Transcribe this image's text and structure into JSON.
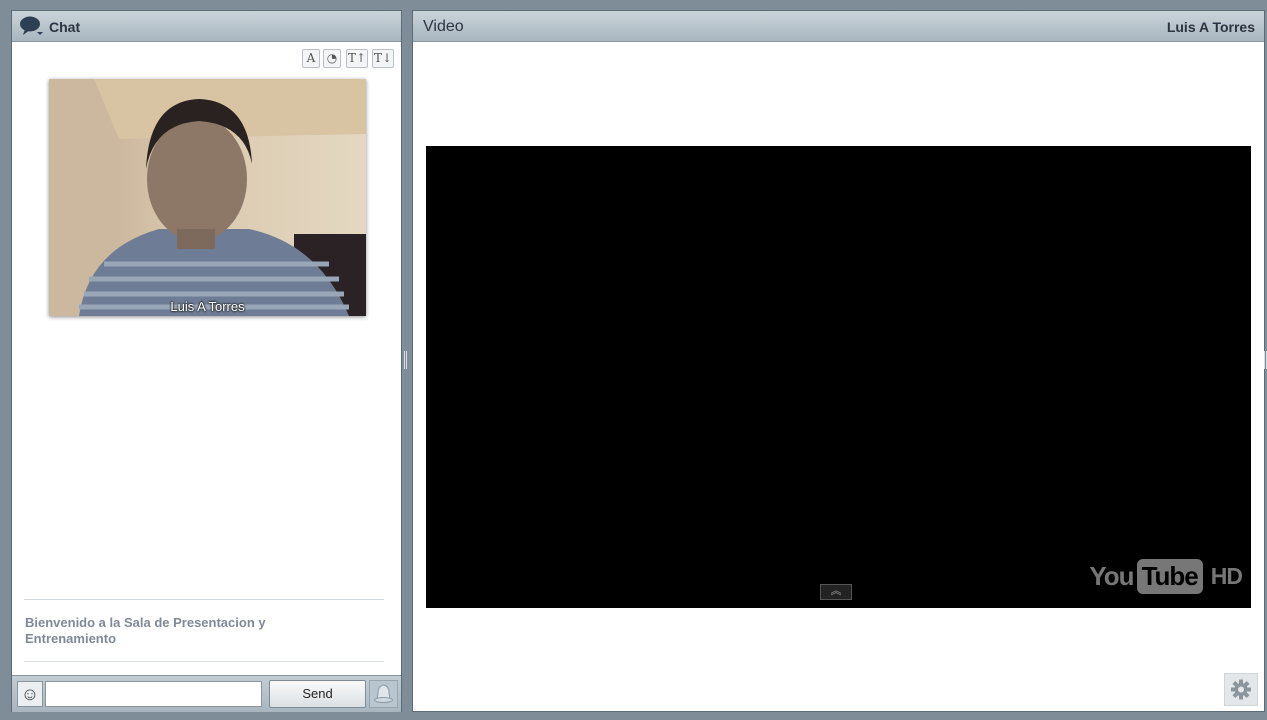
{
  "chat": {
    "title": "Chat",
    "toolbar": [
      {
        "name": "font-style-button",
        "glyph": "A"
      },
      {
        "name": "clock-button",
        "glyph": "◔"
      },
      {
        "name": "font-increase-button",
        "glyph": "T↑"
      },
      {
        "name": "font-decrease-button",
        "glyph": "T↓"
      }
    ],
    "webcam": {
      "name": "Luis A Torres"
    },
    "welcome_message": "Bienvenido a la Sala de Presentacion y Entrenamiento",
    "input": {
      "value": "",
      "placeholder": ""
    },
    "send_label": "Send"
  },
  "video": {
    "title": "Video",
    "presenter": "Luis A Torres",
    "player": {
      "logo_you": "You",
      "logo_tube": "Tube",
      "logo_hd": "HD"
    }
  },
  "colors": {
    "app_background": "#7f8d99",
    "header_gradient_top": "#c9d3da",
    "header_gradient_bottom": "#a9b6bf",
    "welcome_text": "#7f8a96"
  }
}
